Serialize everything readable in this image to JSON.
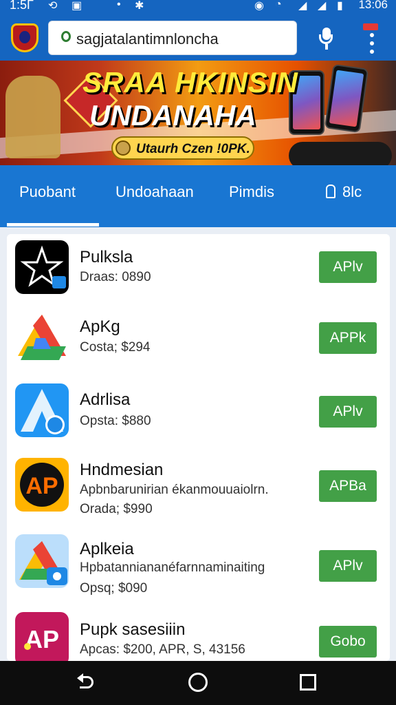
{
  "status_bar": {
    "time": "1:5Γ",
    "right_time": "13:06"
  },
  "browser": {
    "url": "sagjatalantimnloncha"
  },
  "banner": {
    "headline_1": "SRAA HKINSIN",
    "headline_2": "UNDANAHA",
    "tag": "Utaurh Czen !0PK."
  },
  "tabs": [
    {
      "label": "Puobant"
    },
    {
      "label": "Undoahaan"
    },
    {
      "label": "Pimdis"
    },
    {
      "label": "8lc"
    }
  ],
  "apps": [
    {
      "name": "Pulksla",
      "line1": "Draas: 0890",
      "line2": "",
      "button": "APlv",
      "icon": "star-app-icon"
    },
    {
      "name": "ApKg",
      "line1": "Costa; $294",
      "line2": "",
      "button": "APPk",
      "icon": "drive-logo-icon"
    },
    {
      "name": "Adrlisa",
      "line1": "Opsta: $880",
      "line2": "",
      "button": "APlv",
      "icon": "blue-a-app-icon"
    },
    {
      "name": "Hndmesian",
      "line1": "Apbnbarunirian ékanmouuaiolrn.",
      "line2": "Orada; $990",
      "button": "APBa",
      "icon": "ap-orange-app-icon"
    },
    {
      "name": "Aplkeia",
      "line1": "Hpbatanniananéfarnnaminaiting",
      "line2": "Opsq; $090",
      "button": "APlv",
      "icon": "drive-chat-app-icon"
    },
    {
      "name": "Pupk sasesiiin",
      "line1": "Apcas: $200, APR, S, 43156",
      "line2": "",
      "button": "Gobo",
      "icon": "ap-magenta-app-icon"
    }
  ]
}
